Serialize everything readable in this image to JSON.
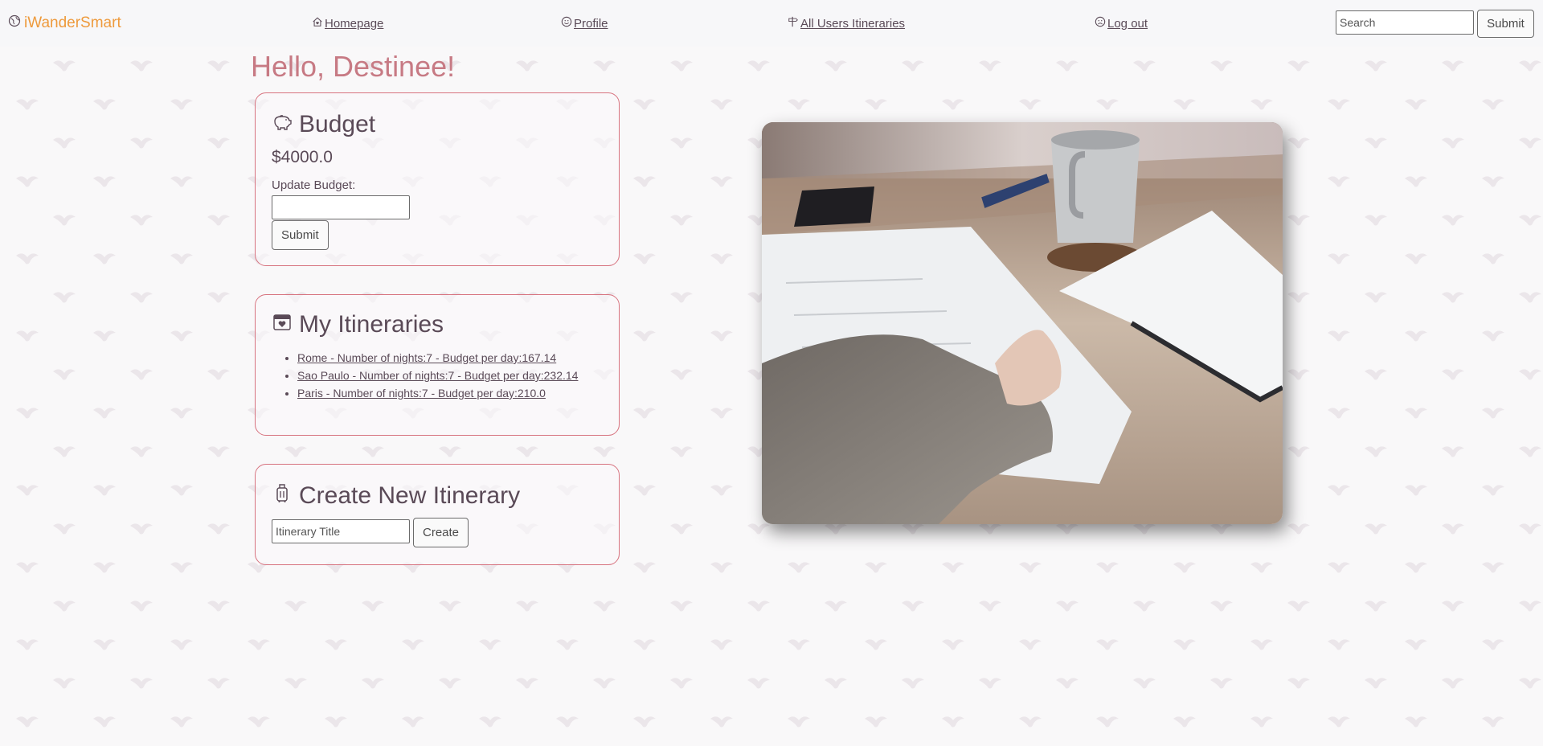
{
  "nav": {
    "brand": "iWanderSmart",
    "links": [
      {
        "label": "Homepage",
        "icon": "house-heart-icon"
      },
      {
        "label": "Profile",
        "icon": "smile-icon"
      },
      {
        "label": "All Users Itineraries",
        "icon": "signpost-icon"
      },
      {
        "label": "Log out",
        "icon": "frown-icon"
      }
    ],
    "search_placeholder": "Search",
    "search_button": "Submit"
  },
  "main": {
    "greeting": "Hello, Destinee!",
    "budget": {
      "title": "Budget",
      "icon": "piggy-bank-icon",
      "amount": "$4000.0",
      "update_label": "Update Budget:",
      "submit_label": "Submit"
    },
    "itineraries": {
      "title": "My Itineraries",
      "icon": "calendar-heart-icon",
      "items": [
        {
          "label": "Rome - Number of nights:7 - Budget per day:167.14"
        },
        {
          "label": "Sao Paulo - Number of nights:7 - Budget per day:232.14"
        },
        {
          "label": "Paris - Number of nights:7 - Budget per day:210.0"
        }
      ]
    },
    "create": {
      "title": "Create New Itinerary",
      "icon": "luggage-icon",
      "input_placeholder": "Itinerary Title",
      "button_label": "Create"
    }
  },
  "colors": {
    "brand": "#ee9a3c",
    "greeting": "#c77a84",
    "card_border": "#d7737f",
    "text": "#5a4a57"
  }
}
